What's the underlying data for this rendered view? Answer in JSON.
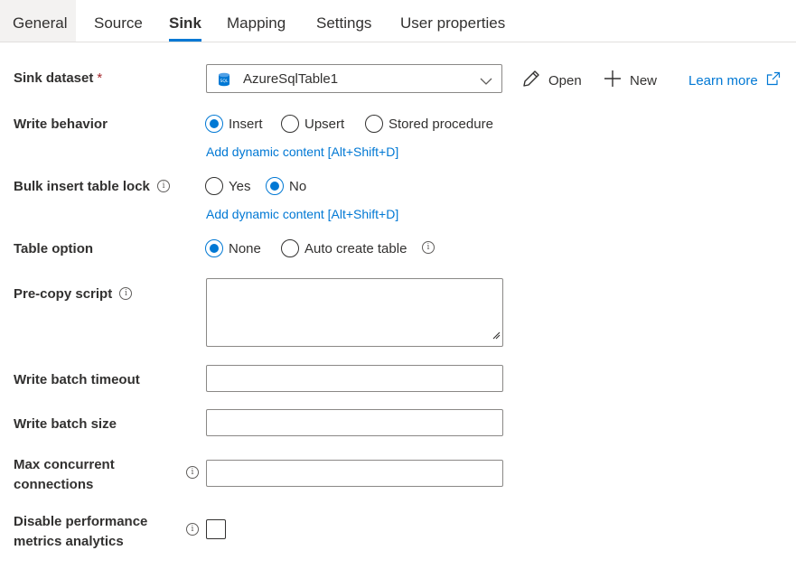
{
  "tabs": {
    "general": "General",
    "source": "Source",
    "sink": "Sink",
    "mapping": "Mapping",
    "settings": "Settings",
    "user_properties": "User properties",
    "active": "Sink"
  },
  "sink_dataset": {
    "label": "Sink dataset",
    "required_mark": "*",
    "value": "AzureSqlTable1",
    "open_label": "Open",
    "new_label": "New",
    "learn_more_label": "Learn more"
  },
  "write_behavior": {
    "label": "Write behavior",
    "options": [
      "Insert",
      "Upsert",
      "Stored procedure"
    ],
    "selected": "Insert",
    "dynamic_content": "Add dynamic content [Alt+Shift+D]"
  },
  "bulk_insert_table_lock": {
    "label": "Bulk insert table lock",
    "options": [
      "Yes",
      "No"
    ],
    "selected": "No",
    "dynamic_content": "Add dynamic content [Alt+Shift+D]"
  },
  "table_option": {
    "label": "Table option",
    "options": [
      "None",
      "Auto create table"
    ],
    "selected": "None"
  },
  "pre_copy_script": {
    "label": "Pre-copy script",
    "value": ""
  },
  "write_batch_timeout": {
    "label": "Write batch timeout",
    "value": ""
  },
  "write_batch_size": {
    "label": "Write batch size",
    "value": ""
  },
  "max_concurrent_connections": {
    "label_line1": "Max concurrent",
    "label_line2": "connections",
    "value": ""
  },
  "disable_performance_metrics": {
    "label_line1": "Disable performance",
    "label_line2": "metrics analytics",
    "checked": false
  },
  "info_glyph": "i",
  "colors": {
    "accent": "#0078d4",
    "text": "#323130",
    "border": "#8a8886",
    "required": "#a4262c"
  }
}
